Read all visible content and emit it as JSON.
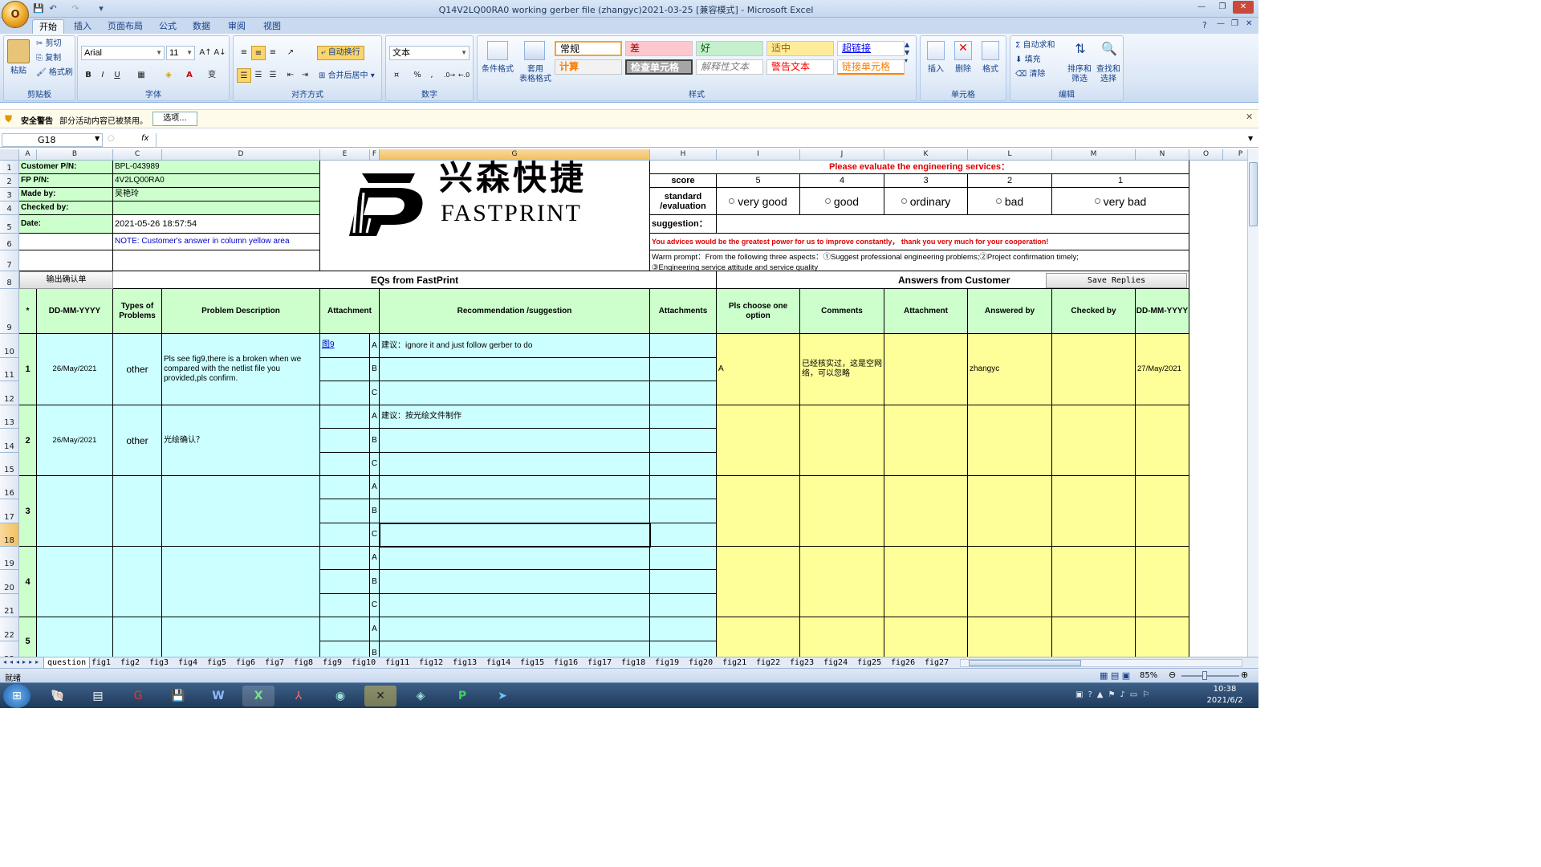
{
  "window": {
    "title": "Q14V2LQ00RA0 working gerber file (zhangyc)2021-03-25  [兼容模式] - Microsoft Excel",
    "office_button": "O",
    "minimize": "—",
    "restore": "❐",
    "close": "✕"
  },
  "ribbon": {
    "tabs": [
      "开始",
      "插入",
      "页面布局",
      "公式",
      "数据",
      "审阅",
      "视图"
    ],
    "clipboard": {
      "paste": "粘贴",
      "cut": "剪切",
      "copy": "复制",
      "format_painter": "格式刷",
      "label": "剪贴板"
    },
    "font": {
      "name": "Arial",
      "size": "11",
      "label": "字体",
      "bold": "B",
      "italic": "I",
      "underline": "U"
    },
    "alignment": {
      "wrap": "自动换行",
      "merge": "合并后居中",
      "label": "对齐方式"
    },
    "number": {
      "format": "文本",
      "label": "数字",
      "percent": "%",
      "comma": ","
    },
    "styles": {
      "label": "样式",
      "conditional": "条件格式",
      "table": "套用\n表格格式",
      "cells": [
        {
          "text": "常规",
          "bg": "#ffffff"
        },
        {
          "text": "差",
          "bg": "#ffc7ce"
        },
        {
          "text": "好",
          "bg": "#c6efce"
        },
        {
          "text": "适中",
          "bg": "#ffeb9c"
        },
        {
          "text": "超链接",
          "bg": "#ffffff"
        },
        {
          "text": "计算",
          "bg": "#f2f2f2"
        },
        {
          "text": "检查单元格",
          "bg": "#a5a5a5"
        },
        {
          "text": "解释性文本",
          "bg": "#ffffff"
        },
        {
          "text": "警告文本",
          "bg": "#ffffff"
        },
        {
          "text": "链接单元格",
          "bg": "#ffffff"
        }
      ]
    },
    "cells_group": {
      "insert": "插入",
      "delete": "删除",
      "format": "格式",
      "label": "单元格"
    },
    "editing": {
      "autosum": "Σ 自动求和",
      "fill": "填充",
      "clear": "清除",
      "sort": "排序和\n筛选",
      "find": "查找和\n选择",
      "label": "编辑"
    }
  },
  "security": {
    "title": "安全警告",
    "message": "部分活动内容已被禁用。",
    "options": "选项..."
  },
  "formula_bar": {
    "name_box": "G18",
    "fx": "fx",
    "value": ""
  },
  "columns": [
    "A",
    "B",
    "C",
    "D",
    "E",
    "F",
    "G",
    "H",
    "I",
    "J",
    "K",
    "L",
    "M",
    "N",
    "O",
    "P"
  ],
  "rows": [
    "1",
    "2",
    "3",
    "4",
    "5",
    "6",
    "7",
    "8",
    "9",
    "10",
    "11",
    "12",
    "13",
    "14",
    "15",
    "16",
    "17",
    "18",
    "19",
    "20",
    "21",
    "22",
    "23"
  ],
  "sheet": {
    "customer_pn_label": "Customer P/N:",
    "customer_pn": "BPL-043989",
    "fp_pn_label": "FP P/N:",
    "fp_pn": "4V2LQ00RA0",
    "made_by_label": "Made by:",
    "made_by": "吴艳玲",
    "checked_by_label": "Checked by:",
    "date_label": "Date:",
    "date": "2021-05-26 18:57:54",
    "note": "NOTE: Customer's  answer in column yellow area",
    "logo_cn": "兴森快捷",
    "logo_en": "FASTPRINT",
    "evaluate_title": "Please evaluate the engineering services：",
    "score_label": "score",
    "scores": [
      "5",
      "4",
      "3",
      "2",
      "1"
    ],
    "standard_label": "standard\n/evaluation",
    "options": [
      "very good",
      "good",
      "ordinary",
      "bad",
      "very bad"
    ],
    "suggestion_label": "suggestion：",
    "advice": "You advices would be the greatest power for us to improve constantly， thank you very much for your cooperation!",
    "warm_prompt": "Warm prompt：From the following three aspects：①Suggest professional engineering problems;②Project confirmation timely;\n③Engineering service attitude and service quality",
    "output_button": "输出确认单",
    "eq_header": "EQs from FastPrint",
    "answers_header": "Answers from Customer",
    "save_replies": "Save Replies",
    "headers": {
      "star": "*",
      "date": "DD-MM-YYYY",
      "types": "Types of\nProblems",
      "problem": "Problem Description",
      "attachment": "Attachment",
      "recommendation": "Recommendation /suggestion",
      "attachments": "Attachments",
      "choose": "Pls choose one\noption",
      "comments": "Comments",
      "attachment2": "Attachment",
      "answered_by": "Answered by",
      "checked_by": "Checked by",
      "date2": "DD-MM-YYYY"
    },
    "abc": [
      "A",
      "B",
      "C"
    ],
    "eqs": [
      {
        "no": "1",
        "date": "26/May/2021",
        "type": "other",
        "problem": "Pls see fig9,there is a broken when we compared with the netlist file you provided,pls confirm.",
        "attachment": "图9",
        "rec_a": "建议：ignore it and just follow gerber to do",
        "choice": "A",
        "comment": "已经核实过，这是空网络，可以忽略",
        "answered_by": "zhangyc",
        "answer_date": "27/May/2021"
      },
      {
        "no": "2",
        "date": "26/May/2021",
        "type": "other",
        "problem": "光绘确认？",
        "attachment": "",
        "rec_a": "建议：按光绘文件制作",
        "choice": "",
        "comment": "",
        "answered_by": "",
        "answer_date": ""
      },
      {
        "no": "3"
      },
      {
        "no": "4"
      },
      {
        "no": "5"
      }
    ]
  },
  "sheet_tabs": [
    "question",
    "fig1",
    "fig2",
    "fig3",
    "fig4",
    "fig5",
    "fig6",
    "fig7",
    "fig8",
    "fig9",
    "fig10",
    "fig11",
    "fig12",
    "fig13",
    "fig14",
    "fig15",
    "fig16",
    "fig17",
    "fig18",
    "fig19",
    "fig20",
    "fig21",
    "fig22",
    "fig23",
    "fig24",
    "fig25",
    "fig26",
    "fig27"
  ],
  "status": {
    "ready": "就绪",
    "zoom": "85%"
  },
  "taskbar": {
    "time": "10:38",
    "date": "2021/6/2"
  },
  "colors": {
    "green": "#ccffcc",
    "cyan": "#ccffff",
    "yellow": "#ffff99",
    "red": "#e00000"
  }
}
